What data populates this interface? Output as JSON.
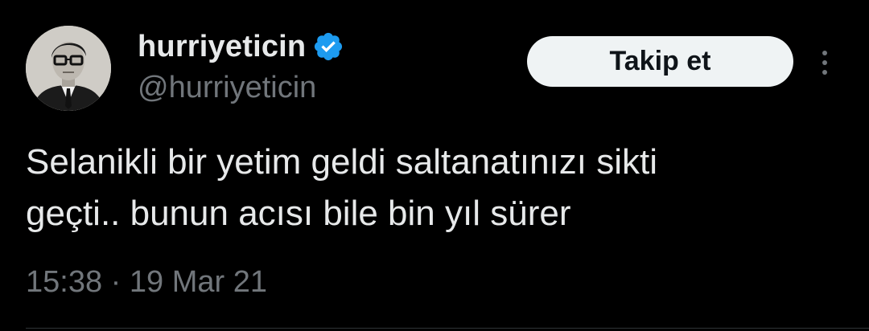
{
  "user": {
    "display_name": "hurriyeticin",
    "handle": "@hurriyeticin",
    "verified": true
  },
  "follow_button_label": "Takip et",
  "tweet": {
    "lines": [
      "Selanikli bir yetim geldi saltanatınızı sikti",
      "geçti.. bunun acısı bile bin yıl sürer"
    ],
    "timestamp": "15:38 · 19 Mar 21"
  },
  "icons": {
    "verified": "verified-badge-icon",
    "more": "more-options-icon"
  },
  "colors": {
    "background": "#000000",
    "text_primary": "#e7e9ea",
    "text_secondary": "#71767b",
    "verified_blue": "#1d9bf0",
    "button_bg": "#eff3f4",
    "button_text": "#0f1419"
  }
}
